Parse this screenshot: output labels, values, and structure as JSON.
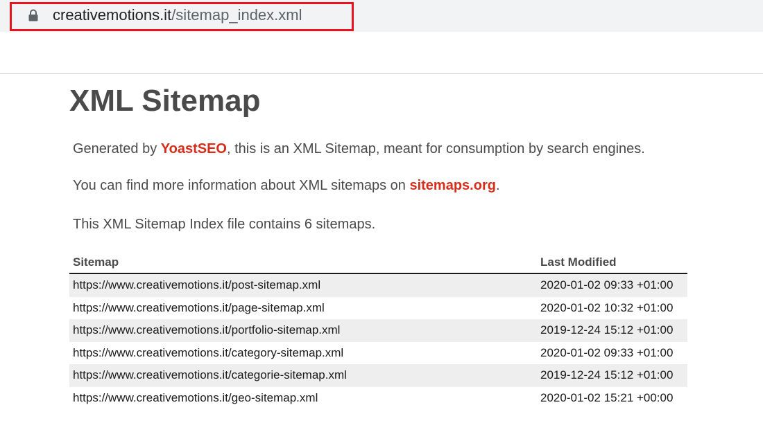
{
  "browser": {
    "url_domain": "creativemotions.it",
    "url_path": "/sitemap_index.xml",
    "highlight_color": "#e8131b"
  },
  "page": {
    "title": "XML Sitemap",
    "intro": {
      "prefix": "Generated by ",
      "link": "YoastSEO",
      "suffix": ", this is an XML Sitemap, meant for consumption by search engines."
    },
    "info": {
      "prefix": "You can find more information about XML sitemaps on ",
      "link": "sitemaps.org",
      "suffix": "."
    },
    "count_text": "This XML Sitemap Index file contains 6 sitemaps.",
    "link_color": "#d62c1a"
  },
  "table": {
    "headers": {
      "sitemap": "Sitemap",
      "last_modified": "Last Modified"
    },
    "rows": [
      {
        "url": "https://www.creativemotions.it/post-sitemap.xml",
        "modified": "2020-01-02 09:33 +01:00"
      },
      {
        "url": "https://www.creativemotions.it/page-sitemap.xml",
        "modified": "2020-01-02 10:32 +01:00"
      },
      {
        "url": "https://www.creativemotions.it/portfolio-sitemap.xml",
        "modified": "2019-12-24 15:12 +01:00"
      },
      {
        "url": "https://www.creativemotions.it/category-sitemap.xml",
        "modified": "2020-01-02 09:33 +01:00"
      },
      {
        "url": "https://www.creativemotions.it/categorie-sitemap.xml",
        "modified": "2019-12-24 15:12 +01:00"
      },
      {
        "url": "https://www.creativemotions.it/geo-sitemap.xml",
        "modified": "2020-01-02 15:21 +00:00"
      }
    ]
  }
}
